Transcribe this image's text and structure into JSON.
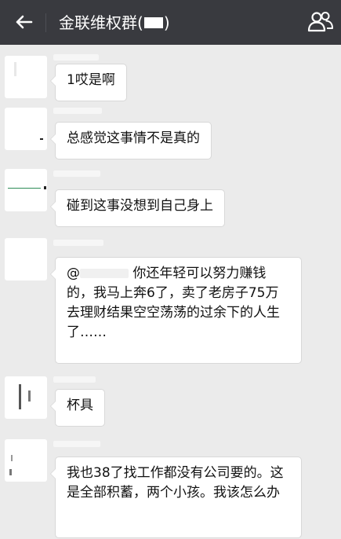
{
  "header": {
    "title": "金联维权群(",
    "title_suffix": ")",
    "back_icon": "arrow-left-icon",
    "group_icon": "group-members-icon"
  },
  "messages": [
    {
      "text": "1哎是啊"
    },
    {
      "text": "总感觉这事情不是真的"
    },
    {
      "text": "碰到这事没想到自己身上"
    },
    {
      "mention_prefix": "@",
      "text": " 你还年轻可以努力赚钱的，我马上奔6了，卖了老房子75万去理财结果空空荡荡的过余下的人生了……"
    },
    {
      "text": "杯具"
    },
    {
      "text": "我也38了找工作都没有公司要的。这是全部积蓄，两个小孩。我该怎么办"
    }
  ],
  "colors": {
    "topbar": "#393a3f",
    "chat_background": "#ebebeb",
    "bubble": "#ffffff"
  }
}
